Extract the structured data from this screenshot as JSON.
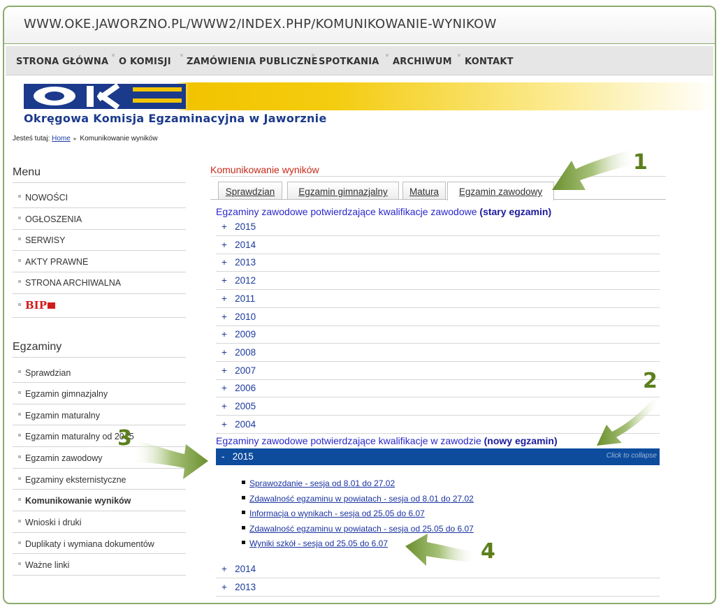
{
  "browser": {
    "url": "WWW.OKE.JAWORZNO.PL/WWW2/INDEX.PHP/KOMUNIKOWANIE-WYNIKOW"
  },
  "top_nav": [
    "STRONA GŁÓWNA",
    "O KOMISJI",
    "ZAMÓWIENIA PUBLICZNE",
    "SPOTKANIA",
    "ARCHIWUM",
    "KONTAKT"
  ],
  "logo": {
    "text": "OKE",
    "org_name": "Okręgowa Komisja Egzaminacyjna w Jaworznie"
  },
  "breadcrumb": {
    "prefix": "Jesteś tutaj:",
    "home": "Home",
    "separator": "▸",
    "current": "Komunikowanie wyników"
  },
  "sidebar": {
    "menu_title": "Menu",
    "menu_items": [
      "NOWOŚCI",
      "OGŁOSZENIA",
      "SERWISY",
      "AKTY PRAWNE",
      "STRONA ARCHIWALNA"
    ],
    "bip_label": "BIP",
    "exams_title": "Egzaminy",
    "exam_items": [
      "Sprawdzian",
      "Egzamin gimnazjalny",
      "Egzamin maturalny",
      "Egzamin maturalny od 2015",
      "Egzamin zawodowy",
      "Egzaminy eksternistyczne",
      "Komunikowanie wyników",
      "Wnioski i druki",
      "Duplikaty i wymiana dokumentów",
      "Ważne linki"
    ]
  },
  "content": {
    "title": "Komunikowanie wyników",
    "tabs": [
      "Sprawdzian",
      "Egzamin gimnazjalny",
      "Matura",
      "Egzamin zawodowy"
    ],
    "active_tab": "Egzamin zawodowy",
    "section_old": {
      "text": "Egzaminy zawodowe potwierdzające kwalifikacje zawodowe",
      "bold": "(stary egzamin)"
    },
    "old_years": [
      "2015",
      "2014",
      "2013",
      "2012",
      "2011",
      "2010",
      "2009",
      "2008",
      "2007",
      "2006",
      "2005",
      "2004"
    ],
    "section_new": {
      "text": "Egzaminy zawodowe potwierdzające kwalifikacje w zawodzie",
      "bold": "(nowy egzamin)"
    },
    "open_year": {
      "label": "2015",
      "sign": "-",
      "collapse_text": "Click to collapse"
    },
    "links": [
      "Sprawozdanie - sesja od 8.01 do 27.02",
      "Zdawalność egzaminu w powiatach - sesja od 8.01 do 27.02",
      "Informacja o wynikach - sesja od 25.05 do 6.07",
      "Zdawalność egzaminu w powiatach - sesja od 25.05 do 6.07",
      "Wyniki szkół - sesja od 25.05 do 6.07"
    ],
    "new_years_rest": [
      "2014",
      "2013"
    ],
    "plus_sign": "+"
  },
  "annotations": [
    "1",
    "2",
    "3",
    "4"
  ],
  "colors": {
    "accent_green": "#5b7f1c",
    "link_blue": "#1a33a0",
    "open_bar": "#0d4c9d",
    "logo_blue": "#1b3a8c",
    "logo_yellow": "#f2c400"
  }
}
